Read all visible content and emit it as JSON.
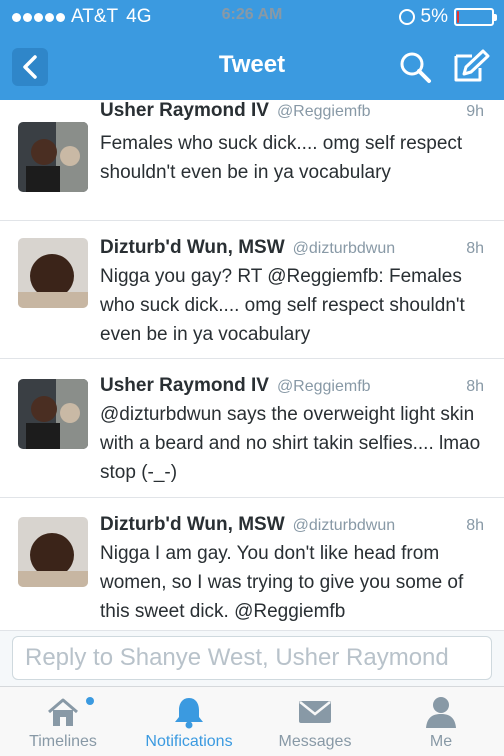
{
  "status": {
    "carrier": "AT&T",
    "network": "4G",
    "time": "6:26 AM",
    "battery_text": "5%",
    "battery_level": 0.05
  },
  "nav": {
    "title": "Tweet",
    "back_icon": "chevron-left-icon",
    "search_icon": "search-icon",
    "compose_icon": "compose-icon"
  },
  "tweets": [
    {
      "name": "Usher Raymond IV",
      "handle": "@Reggiemfb",
      "time": "9h",
      "text": "Females who suck dick.... omg self respect shouldn't even be in ya vocabulary"
    },
    {
      "name": "Dizturb'd Wun, MSW",
      "handle": "@dizturbdwun",
      "time": "8h",
      "text": "Nigga you gay? RT @Reggiemfb: Females who suck dick.... omg self respect shouldn't even be in ya vocabulary"
    },
    {
      "name": "Usher Raymond IV",
      "handle": "@Reggiemfb",
      "time": "8h",
      "text": "@dizturbdwun says the overweight light skin with a beard and no shirt takin selfies.... lmao stop (-_-)"
    },
    {
      "name": "Dizturb'd Wun, MSW",
      "handle": "@dizturbdwun",
      "time": "8h",
      "text": "Nigga I am gay. You don't like head from women, so I was trying to give you some of this sweet dick. @Reggiemfb"
    }
  ],
  "reply": {
    "placeholder": "Reply to Shanye West, Usher Raymond"
  },
  "tabs": [
    {
      "label": "Timelines",
      "icon": "home-icon"
    },
    {
      "label": "Notifications",
      "icon": "bell-icon"
    },
    {
      "label": "Messages",
      "icon": "envelope-icon"
    },
    {
      "label": "Me",
      "icon": "person-icon"
    }
  ],
  "colors": {
    "brand": "#3b9ae0",
    "battery_low": "#e33333"
  }
}
